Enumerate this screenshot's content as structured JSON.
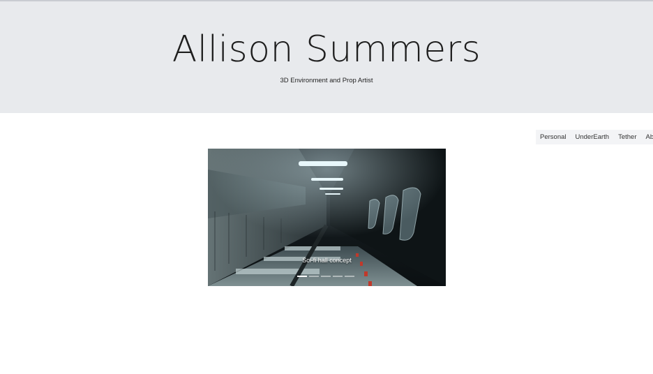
{
  "header": {
    "title": "Allison Summers",
    "subtitle": "3D Environment and Prop Artist"
  },
  "nav": {
    "items": [
      {
        "label": "Personal"
      },
      {
        "label": "UnderEarth"
      },
      {
        "label": "Tether"
      },
      {
        "label": "About"
      }
    ]
  },
  "carousel": {
    "caption": "Sci-fi hall concept",
    "slide_count": 5,
    "active_slide": 1,
    "image_icon": "sci-fi-hall-render-image"
  },
  "colors": {
    "header_bg": "#e8eaed",
    "nav_bg": "#f3f4f6",
    "page_bg": "#ffffff"
  }
}
